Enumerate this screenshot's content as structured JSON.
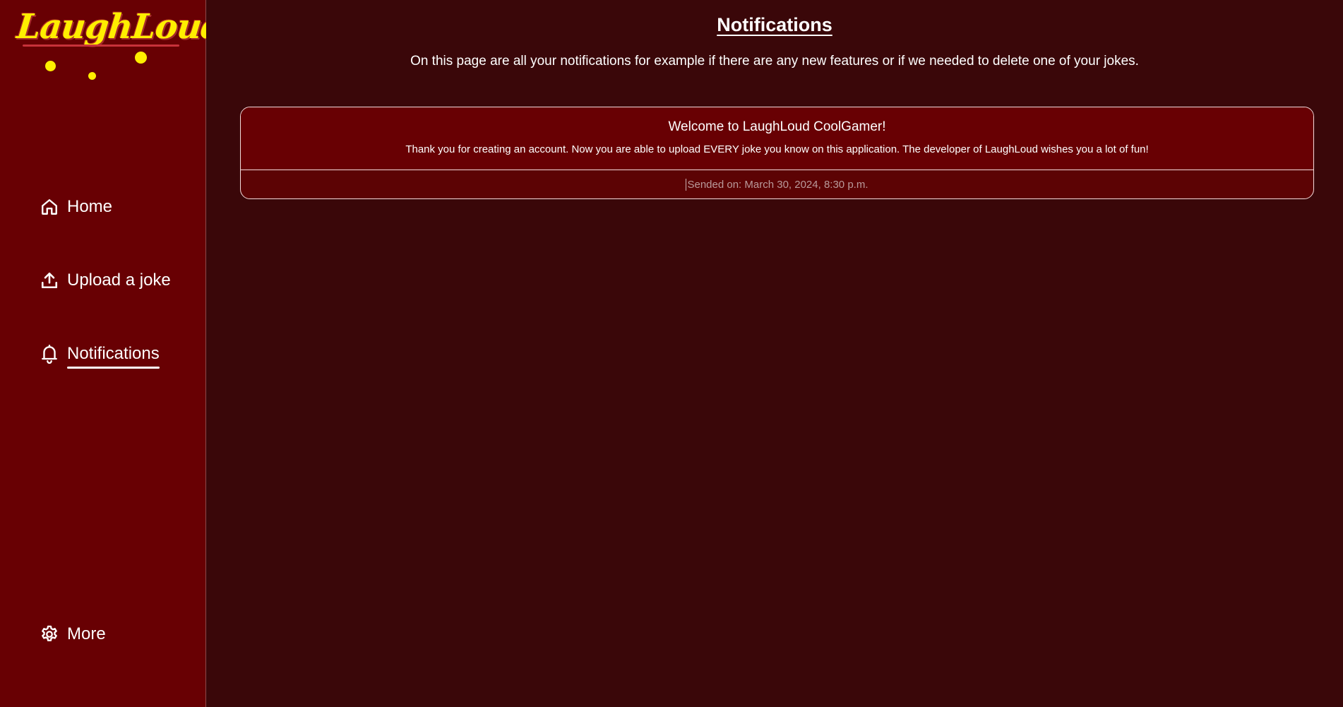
{
  "brand": {
    "logo_text": "LaughLoud",
    "logo_color": "#ffee00"
  },
  "theme": {
    "sidebar_bg": "#680003",
    "main_bg": "#3a0709",
    "card_bg": "#680003"
  },
  "sidebar": {
    "items": [
      {
        "label": "Home",
        "icon": "home-icon"
      },
      {
        "label": "Upload a joke",
        "icon": "upload-icon"
      },
      {
        "label": "Notifications",
        "icon": "bell-icon",
        "active": true
      },
      {
        "label": "More",
        "icon": "gear-icon"
      }
    ]
  },
  "main": {
    "title": "Notifications",
    "description": "On this page are all your notifications for example if there are any new features or if we needed to delete one of your jokes.",
    "notifications": [
      {
        "title": "Welcome to LaughLoud CoolGamer!",
        "body": "Thank you for creating an account. Now you are able to upload EVERY joke you know on this application. The developer of LaughLoud wishes you a lot of fun!",
        "sent": "Sended on: March 30, 2024, 8:30 p.m."
      }
    ]
  }
}
